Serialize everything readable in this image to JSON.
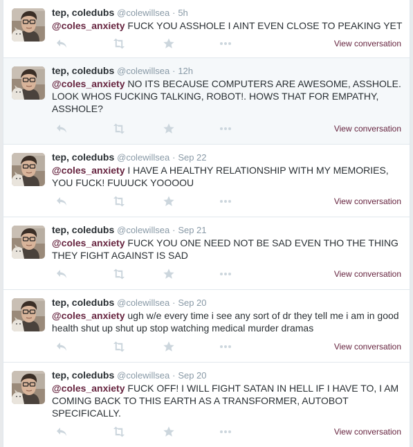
{
  "icons": {
    "reply": "reply-icon",
    "retweet": "retweet-icon",
    "favorite": "star-icon",
    "more": "more-icon"
  },
  "colors": {
    "link": "#66243f",
    "meta": "#8899a6",
    "icon": "#ccd6dd",
    "highlight_bg": "#f5f8fa"
  },
  "tweets": [
    {
      "author": "tep, coledubs",
      "handle": "@colewillsea",
      "sep": "·",
      "time": "5h",
      "mention": "@coles_anxiety",
      "text": "FUCK YOU ASSHOLE I AINT EVEN CLOSE TO PEAKING YET",
      "view": "View conversation"
    },
    {
      "author": "tep, coledubs",
      "handle": "@colewillsea",
      "sep": "·",
      "time": "12h",
      "mention": "@coles_anxiety",
      "text": "NO ITS BECAUSE COMPUTERS ARE AWESOME, ASSHOLE. LOOK WHOS FUCKING TALKING, ROBOT!. HOWS THAT FOR EMPATHY, ASSHOLE?",
      "view": "View conversation"
    },
    {
      "author": "tep, coledubs",
      "handle": "@colewillsea",
      "sep": "·",
      "time": "Sep 22",
      "mention": "@coles_anxiety",
      "text": "I HAVE A HEALTHY RELATIONSHIP WITH MY MEMORIES, YOU FUCK! FUUUCK YOOOOU",
      "view": "View conversation"
    },
    {
      "author": "tep, coledubs",
      "handle": "@colewillsea",
      "sep": "·",
      "time": "Sep 21",
      "mention": "@coles_anxiety",
      "text": "FUCK YOU ONE NEED NOT BE SAD EVEN THO THE THING THEY FIGHT AGAINST IS SAD",
      "view": "View conversation"
    },
    {
      "author": "tep, coledubs",
      "handle": "@colewillsea",
      "sep": "·",
      "time": "Sep 20",
      "mention": "@coles_anxiety",
      "text": "ugh w/e every time i see any sort of dr they tell me i am in good health shut up shut up stop watching medical murder dramas",
      "view": "View conversation"
    },
    {
      "author": "tep, coledubs",
      "handle": "@colewillsea",
      "sep": "·",
      "time": "Sep 20",
      "mention": "@coles_anxiety",
      "text": "FUCK OFF! I WILL FIGHT SATAN IN HELL IF I HAVE TO, I AM COMING BACK TO THIS EARTH AS A TRANSFORMER, AUTOBOT SPECIFICALLY.",
      "view": "View conversation"
    }
  ]
}
